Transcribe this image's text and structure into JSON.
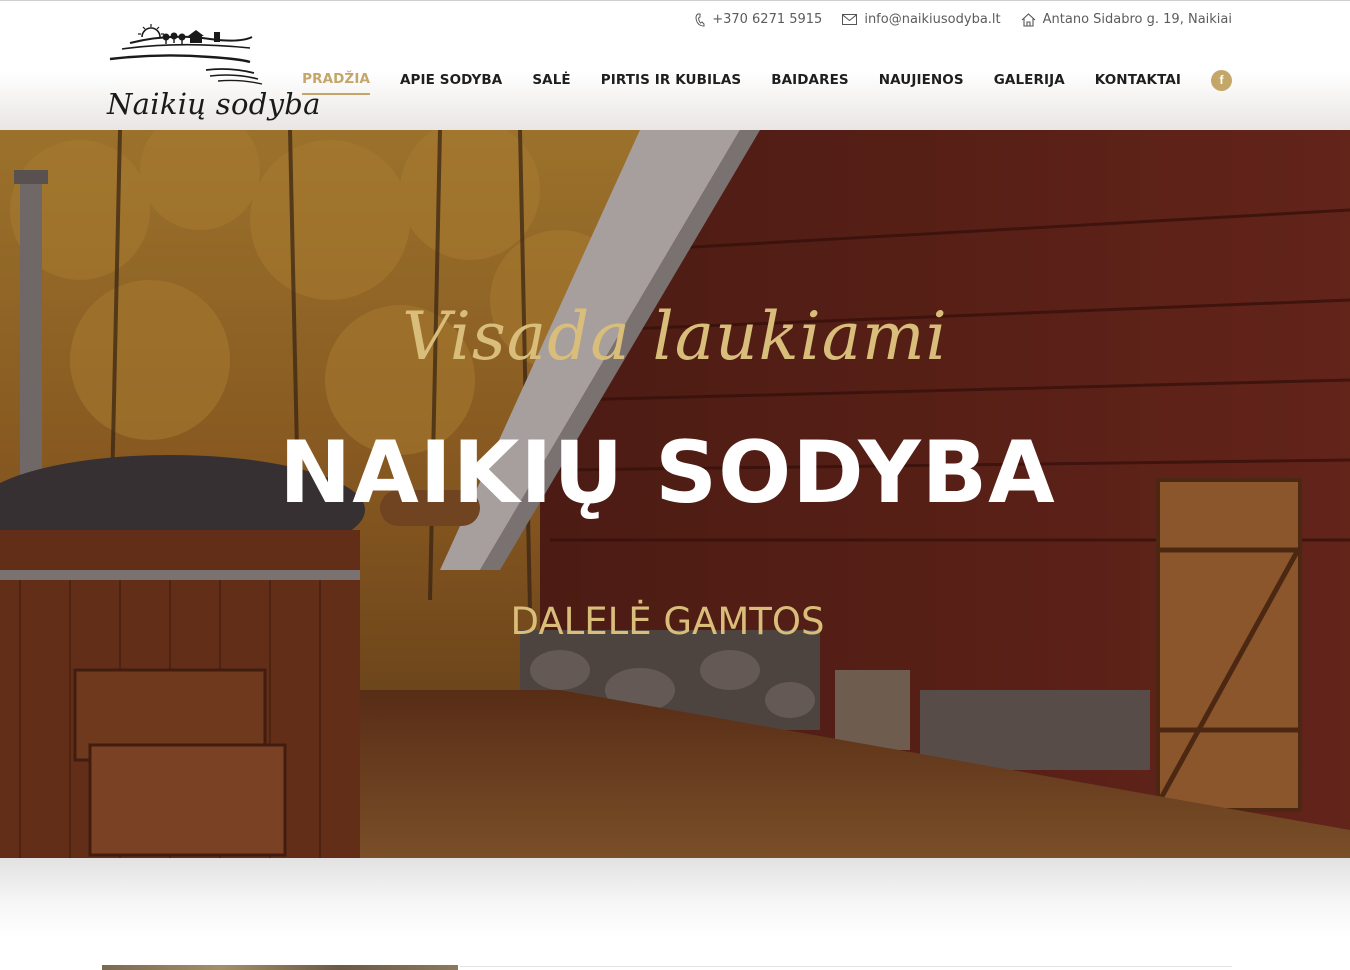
{
  "header": {
    "logo_text": "Naikių sodyba",
    "contacts": {
      "phone": "+370 6271 5915",
      "email": "info@naikiusodyba.lt",
      "address": "Antano Sidabro g. 19, Naikiai"
    },
    "contact_icons": [
      "phone-icon",
      "mail-icon",
      "home-icon"
    ],
    "nav": [
      {
        "label": "PRADŽIA",
        "active": true
      },
      {
        "label": "APIE SODYBA",
        "active": false
      },
      {
        "label": "SALĖ",
        "active": false
      },
      {
        "label": "PIRTIS IR KUBILAS",
        "active": false
      },
      {
        "label": "BAIDARES",
        "active": false
      },
      {
        "label": "NAUJIENOS",
        "active": false
      },
      {
        "label": "GALERIJA",
        "active": false
      },
      {
        "label": "KONTAKTAI",
        "active": false
      }
    ],
    "social_icon": "facebook-icon",
    "social_label": "f"
  },
  "hero": {
    "script_text": "Visada laukiami",
    "title": "NAIKIŲ SODYBA",
    "subtitle": "DALELĖ GAMTOS"
  },
  "colors": {
    "accent": "#c4a768",
    "hero_script": "#d9bd7a",
    "nav_text": "#1e1e1e",
    "hero_title": "#ffffff"
  }
}
